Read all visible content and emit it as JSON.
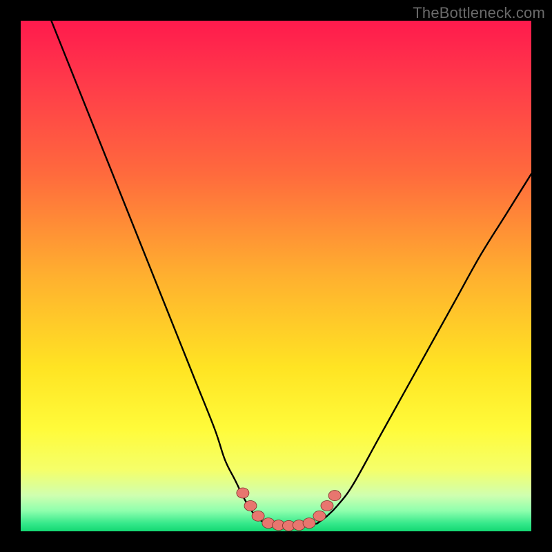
{
  "watermark": "TheBottleneck.com",
  "colors": {
    "black": "#000000",
    "curve": "#000000",
    "dot_fill": "#e8766f",
    "dot_stroke": "#7c2e28",
    "gradient_stops": [
      {
        "offset": "0%",
        "color": "#ff1a4d"
      },
      {
        "offset": "12%",
        "color": "#ff3a4a"
      },
      {
        "offset": "30%",
        "color": "#ff6a3d"
      },
      {
        "offset": "50%",
        "color": "#ffb02f"
      },
      {
        "offset": "68%",
        "color": "#ffe423"
      },
      {
        "offset": "80%",
        "color": "#fffb3a"
      },
      {
        "offset": "88%",
        "color": "#f5ff6a"
      },
      {
        "offset": "93%",
        "color": "#cfffb0"
      },
      {
        "offset": "96%",
        "color": "#8effad"
      },
      {
        "offset": "98.5%",
        "color": "#34e88a"
      },
      {
        "offset": "100%",
        "color": "#14d873"
      }
    ]
  },
  "chart_data": {
    "type": "line",
    "title": "",
    "xlabel": "",
    "ylabel": "",
    "xlim": [
      0,
      100
    ],
    "ylim": [
      0,
      100
    ],
    "series": [
      {
        "name": "bottleneck-curve-left",
        "x": [
          6,
          10,
          14,
          18,
          22,
          26,
          30,
          34,
          38,
          40,
          42,
          44,
          46,
          48
        ],
        "y": [
          100,
          90,
          80,
          70,
          60,
          50,
          40,
          30,
          20,
          14,
          10,
          6,
          3,
          1.5
        ]
      },
      {
        "name": "bottleneck-curve-right",
        "x": [
          58,
          60,
          62,
          65,
          70,
          75,
          80,
          85,
          90,
          95,
          100
        ],
        "y": [
          1.5,
          3,
          5,
          9,
          18,
          27,
          36,
          45,
          54,
          62,
          70
        ]
      },
      {
        "name": "bottleneck-floor",
        "x": [
          48,
          50,
          52,
          54,
          56,
          58
        ],
        "y": [
          1.5,
          1.2,
          1.1,
          1.1,
          1.2,
          1.5
        ]
      }
    ],
    "dots": [
      {
        "x": 43.5,
        "y": 7.5
      },
      {
        "x": 45.0,
        "y": 5.0
      },
      {
        "x": 46.5,
        "y": 3.0
      },
      {
        "x": 48.5,
        "y": 1.6
      },
      {
        "x": 50.5,
        "y": 1.2
      },
      {
        "x": 52.5,
        "y": 1.1
      },
      {
        "x": 54.5,
        "y": 1.2
      },
      {
        "x": 56.5,
        "y": 1.6
      },
      {
        "x": 58.5,
        "y": 3.0
      },
      {
        "x": 60.0,
        "y": 5.0
      },
      {
        "x": 61.5,
        "y": 7.0
      }
    ]
  }
}
